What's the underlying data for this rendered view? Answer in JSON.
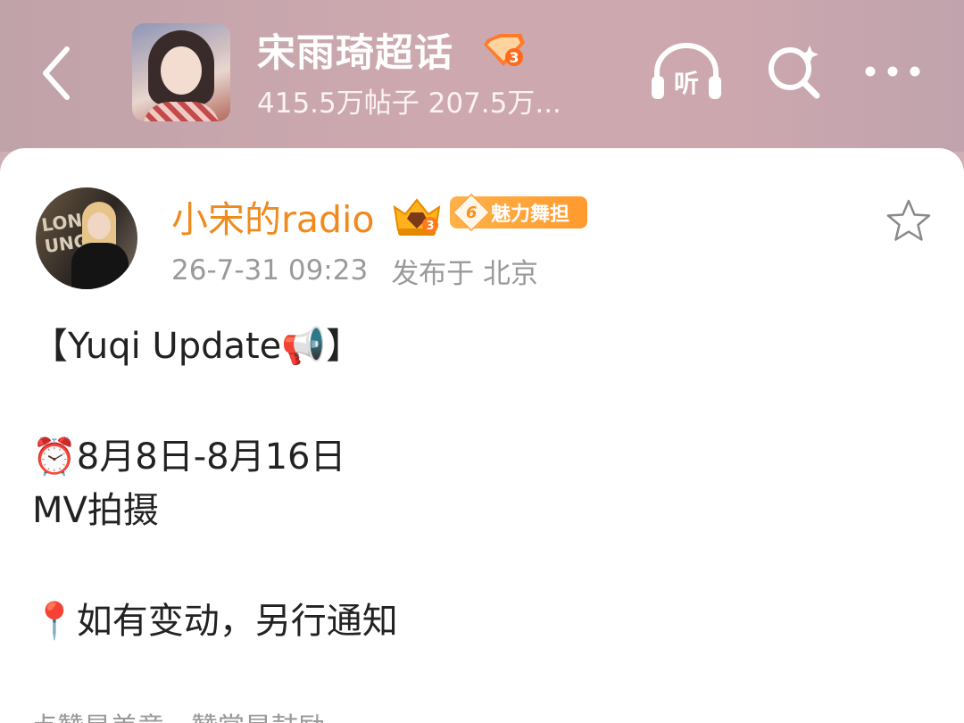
{
  "header": {
    "back_icon": "back-arrow-icon",
    "topic_title": "宋雨琦超话",
    "topic_stats": "415.5万帖子 207.5万...",
    "rank_badge_number": "3",
    "listen_label": "听",
    "icons": [
      "headphones-icon",
      "search-icon",
      "more-icon"
    ]
  },
  "post": {
    "username": "小宋的radio",
    "fan_badge": {
      "level": "6",
      "label": "魅力舞担"
    },
    "timestamp": "26-7-31 09:23",
    "location": "发布于 北京",
    "lines": [
      "【Yuqi Update📢】",
      "⏰8月8日-8月16日",
      "MV拍摄",
      "📍如有变动，另行通知"
    ],
    "footer_hint": "点赞是美意，赞赏是鼓励"
  },
  "colors": {
    "accent_orange": "#f08a1e",
    "badge_orange": "#ff9a2e",
    "header_bg": "#cba8ae",
    "meta_gray": "#9a9a9a"
  }
}
